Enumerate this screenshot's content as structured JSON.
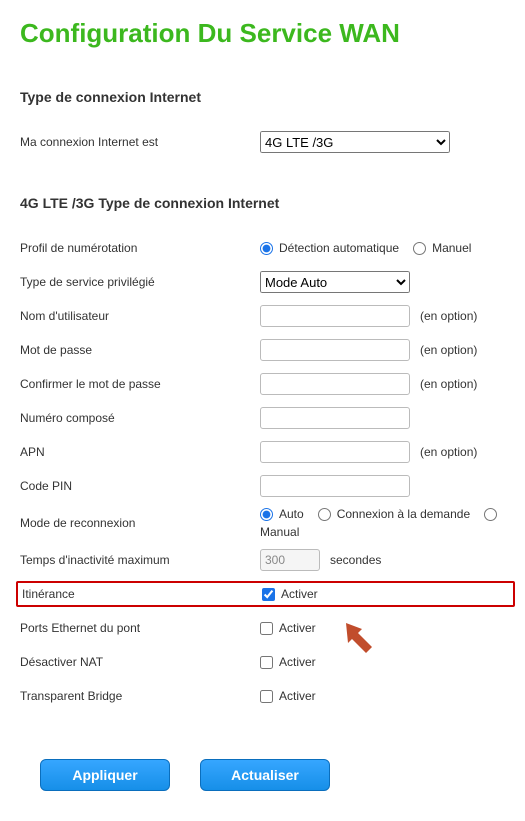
{
  "title": "Configuration Du Service WAN",
  "section1": {
    "heading": "Type de connexion Internet",
    "my_conn_label": "Ma connexion Internet est",
    "my_conn_value": "4G LTE /3G"
  },
  "section2": {
    "heading": "4G LTE /3G Type de connexion Internet",
    "dial_profile": {
      "label": "Profil de numérotation",
      "auto": "Détection automatique",
      "manual": "Manuel",
      "selected": "auto"
    },
    "service_type": {
      "label": "Type de service privilégié",
      "value": "Mode Auto"
    },
    "username": {
      "label": "Nom d'utilisateur",
      "value": "",
      "hint": "(en option)"
    },
    "password": {
      "label": "Mot de passe",
      "value": "",
      "hint": "(en option)"
    },
    "confirm_pw": {
      "label": "Confirmer le mot de passe",
      "value": "",
      "hint": "(en option)"
    },
    "dialed_num": {
      "label": "Numéro composé",
      "value": ""
    },
    "apn": {
      "label": "APN",
      "value": "",
      "hint": "(en option)"
    },
    "pin": {
      "label": "Code PIN",
      "value": ""
    },
    "reconnect": {
      "label": "Mode de reconnexion",
      "auto": "Auto",
      "demand": "Connexion à la demande",
      "manual": "Manual",
      "selected": "auto"
    },
    "idle_time": {
      "label": "Temps d'inactivité maximum",
      "value": "300",
      "suffix": "secondes"
    },
    "roaming": {
      "label": "Itinérance",
      "checkbox_label": "Activer",
      "checked": true
    },
    "bridge_ports": {
      "label": "Ports Ethernet du pont",
      "checkbox_label": "Activer",
      "checked": false
    },
    "disable_nat": {
      "label": "Désactiver NAT",
      "checkbox_label": "Activer",
      "checked": false
    },
    "transparent_bridge": {
      "label": "Transparent Bridge",
      "checkbox_label": "Activer",
      "checked": false
    }
  },
  "buttons": {
    "apply": "Appliquer",
    "refresh": "Actualiser"
  }
}
